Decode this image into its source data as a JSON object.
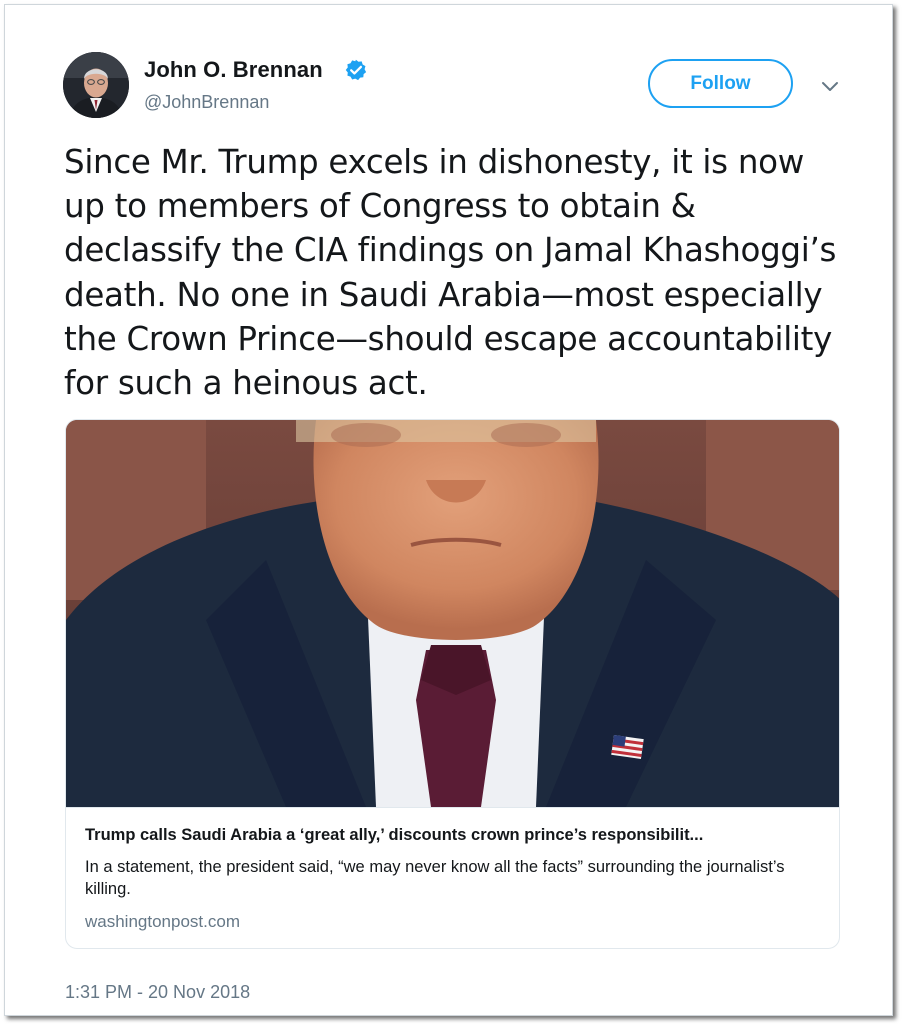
{
  "author": {
    "display_name": "John O. Brennan",
    "handle": "@JohnBrennan",
    "verified": true,
    "avatar_icon": "profile-photo"
  },
  "follow_button": {
    "label": "Follow"
  },
  "menu": {
    "icon": "chevron-down-icon"
  },
  "tweet": {
    "text": "Since Mr. Trump excels in dishonesty, it is now up to members of Congress to obtain & declassify the CIA findings on Jamal Khashoggi’s death. No one in Saudi Arabia—most especially the Crown Prince—should escape accountability for such a heinous act.",
    "timestamp": "1:31 PM - 20 Nov 2018"
  },
  "link_card": {
    "title": "Trump calls Saudi Arabia a ‘great ally,’ discounts crown prince’s responsibilit...",
    "description": "In a statement, the president said, “we may never know all the facts” surrounding the journalist’s killing.",
    "domain": "washingtonpost.com"
  },
  "colors": {
    "accent": "#1da1f2",
    "text": "#14171a",
    "secondary_text": "#657786",
    "border": "#e1e8ed"
  }
}
